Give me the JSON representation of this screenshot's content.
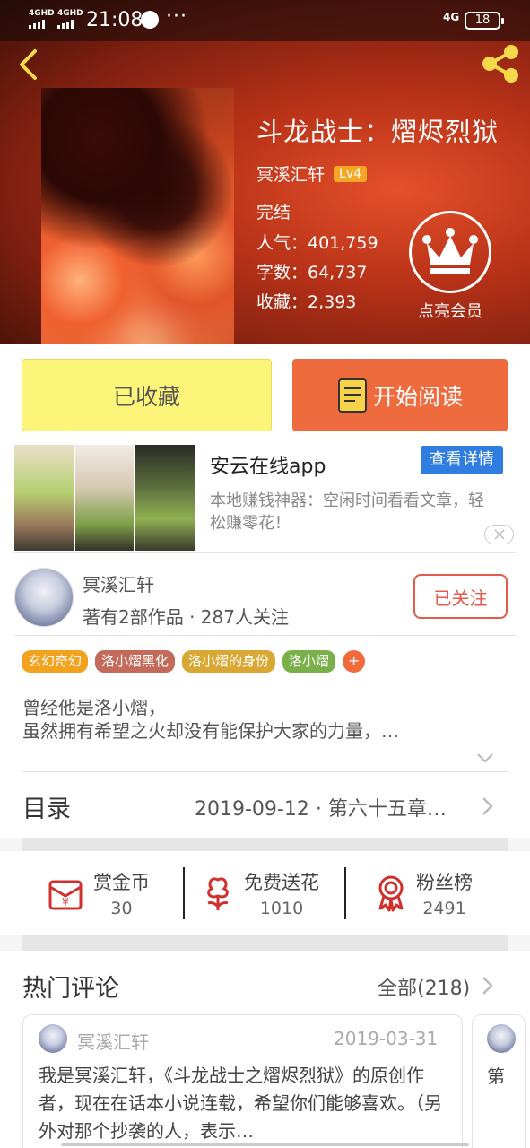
{
  "status_bar": {
    "net1": "4GHD",
    "net2": "4GHD",
    "time": "21:08",
    "dots": "···",
    "net_right": "4G",
    "battery": "18"
  },
  "book": {
    "title": "斗龙战士：熠烬烈狱",
    "author": "冥溪汇轩",
    "level": "Lv4",
    "status": "完结",
    "popularity": "人气：401,759",
    "word_count": "字数：64,737",
    "favorites": "收藏：2,393",
    "vip_label": "点亮会员"
  },
  "actions": {
    "collect_label": "已收藏",
    "read_label": "开始阅读"
  },
  "ad": {
    "title": "安云在线app",
    "button": "查看详情",
    "desc": "本地赚钱神器：空闲时间看看文章，轻松赚零花！"
  },
  "author_info": {
    "name": "冥溪汇轩",
    "works": "著有2部作品 · 287人关注",
    "follow_label": "已关注"
  },
  "tags": [
    {
      "label": "玄幻奇幻",
      "color": "#f3a21e"
    },
    {
      "label": "洛小熠黑化",
      "color": "#c46a5a"
    },
    {
      "label": "洛小熠的身份",
      "color": "#d9a834"
    },
    {
      "label": "洛小熠",
      "color": "#7ab04a"
    }
  ],
  "tag_more": "+",
  "intro": {
    "line1": "曾经他是洛小熠，",
    "line2": "虽然拥有希望之火却没有能保护大家的力量，…"
  },
  "toc": {
    "label": "目录",
    "latest": "2019-09-12 · 第六十五章…"
  },
  "rewards": [
    {
      "label": "赏金币",
      "value": "30"
    },
    {
      "label": "免费送花",
      "value": "1010"
    },
    {
      "label": "粉丝榜",
      "value": "2491"
    }
  ],
  "comments": {
    "title": "热门评论",
    "all": "全部(218)",
    "first": {
      "name": "冥溪汇轩",
      "date": "2019-03-31",
      "text": "我是冥溪汇轩，《斗龙战士之熠烬烈狱》的原创作者，现在在话本小说连载，希望你们能够喜欢。（另外对那个抄袭的人，表示…"
    },
    "second_preview": "第"
  },
  "colors": {
    "accent_orange": "#ee6b3d",
    "collect_yellow": "#fdf57a",
    "follow_red": "#e35a4d",
    "ad_blue": "#2f7de1"
  }
}
